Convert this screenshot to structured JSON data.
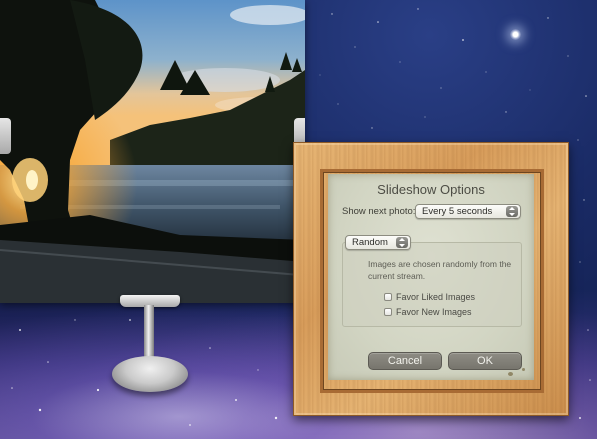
{
  "dialog": {
    "title": "Slideshow Options",
    "show_next_label": "Show next photo:",
    "interval_value": "Every 5 seconds",
    "mode_value": "Random",
    "mode_description": "Images are chosen randomly from the current stream.",
    "favor_liked_label": "Favor Liked Images",
    "favor_liked_checked": false,
    "favor_new_label": "Favor New Images",
    "favor_new_checked": false,
    "cancel_label": "Cancel",
    "ok_label": "OK"
  },
  "photo": {
    "subject": "sunset over lake with trees",
    "icons": [
      "left-tab-icon",
      "right-tab-icon"
    ]
  },
  "colors": {
    "wood": "#d99e5c",
    "panel": "#d2d5c3",
    "button": "#7f7d75",
    "sky": "#1a2b66"
  }
}
